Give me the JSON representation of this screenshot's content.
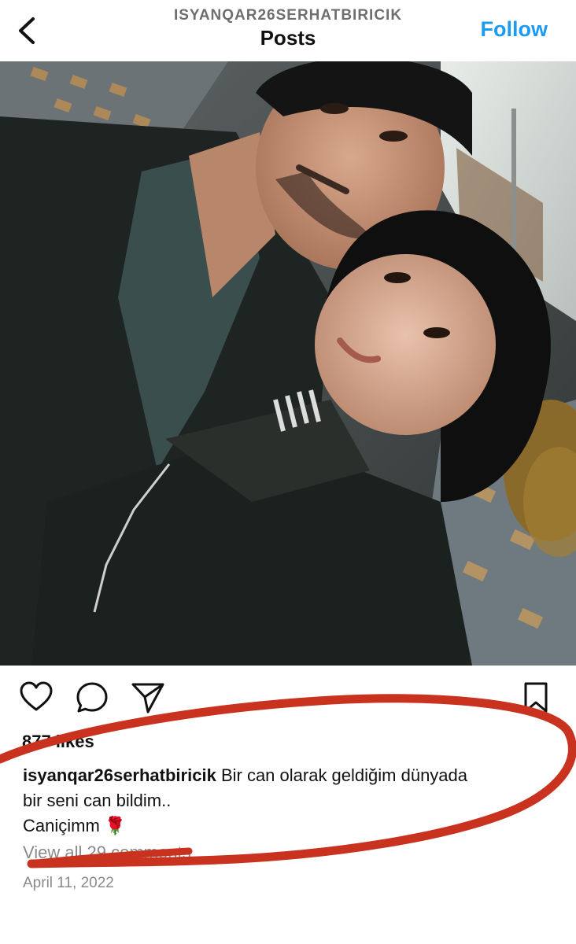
{
  "header": {
    "username": "ISYANQAR26SERHATBIRICIK",
    "title": "Posts",
    "follow_label": "Follow"
  },
  "post": {
    "likes": "877 likes",
    "caption_user": "isyanqar26serhatbiricik",
    "caption_line1": "Bir can olarak geldiğim dünyada",
    "caption_line2": "bir seni can bildim..",
    "caption_line3": "Caniçimm 🌹",
    "view_comments": "View all 29 comments",
    "date": "April 11, 2022"
  },
  "icons": {
    "back": "chevron-left-icon",
    "like": "heart-icon",
    "comment": "comment-bubble-icon",
    "share": "paper-plane-icon",
    "save": "bookmark-icon"
  },
  "colors": {
    "follow": "#1d9bf0",
    "annotation": "#c8321e"
  }
}
